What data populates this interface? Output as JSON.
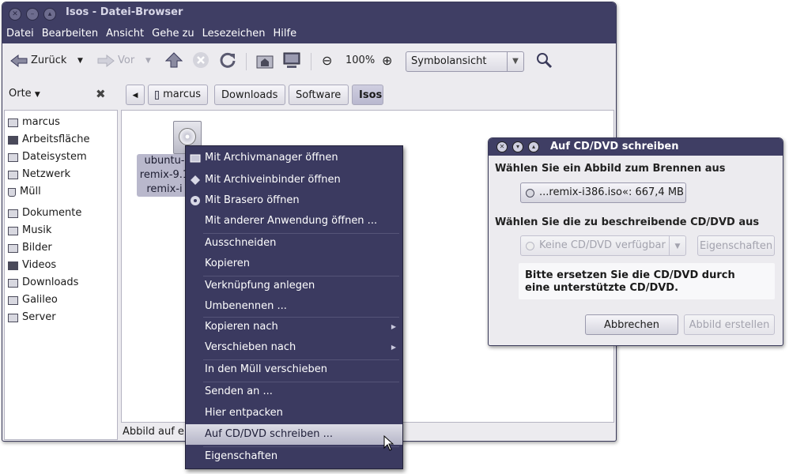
{
  "window": {
    "title": "Isos - Datei-Browser",
    "menus": [
      "Datei",
      "Bearbeiten",
      "Ansicht",
      "Gehe zu",
      "Lesezeichen",
      "Hilfe"
    ]
  },
  "toolbar": {
    "back": "Zurück",
    "forward": "Vor",
    "zoom": "100%",
    "view": "Symbolansicht"
  },
  "sidebar": {
    "header": "Orte",
    "items": [
      "marcus",
      "Arbeitsfläche",
      "Dateisystem",
      "Netzwerk",
      "Müll",
      "Dokumente",
      "Musik",
      "Bilder",
      "Videos",
      "Downloads",
      "Galileo",
      "Server"
    ]
  },
  "breadcrumbs": [
    "marcus",
    "Downloads",
    "Software",
    "Isos"
  ],
  "file": {
    "lines": [
      "ubuntu-",
      "remix-9.1",
      "remix-i"
    ]
  },
  "status": "Abbild auf ei",
  "context_menu": [
    {
      "label": "Mit Archivmanager öffnen",
      "icon": "archive-manager-icon"
    },
    {
      "label": "Mit Archiveinbinder öffnen",
      "icon": "archive-mounter-icon"
    },
    {
      "label": "Mit Brasero öffnen",
      "icon": "brasero-icon"
    },
    {
      "label": "Mit anderer Anwendung öffnen ..."
    },
    {
      "label": "Ausschneiden"
    },
    {
      "label": "Kopieren"
    },
    {
      "label": "Verknüpfung anlegen"
    },
    {
      "label": "Umbenennen ..."
    },
    {
      "label": "Kopieren nach"
    },
    {
      "label": "Verschieben nach"
    },
    {
      "label": "In den Müll verschieben"
    },
    {
      "label": "Senden an ..."
    },
    {
      "label": "Hier entpacken"
    },
    {
      "label": "Auf CD/DVD schreiben ..."
    },
    {
      "label": "Eigenschaften"
    }
  ],
  "dialog": {
    "title": "Auf CD/DVD schreiben",
    "image_heading": "Wählen Sie ein Abbild zum Brennen aus",
    "image_file": "...remix-i386.iso«: 667,4 MB",
    "disc_heading": "Wählen Sie die zu beschreibende CD/DVD aus",
    "disc_select": "Keine CD/DVD verfügbar",
    "properties": "Eigenschaften",
    "message_line1": "Bitte ersetzen Sie die CD/DVD durch",
    "message_line2": "eine unterstützte CD/DVD.",
    "cancel": "Abbrechen",
    "create_image": "Abbild erstellen"
  }
}
